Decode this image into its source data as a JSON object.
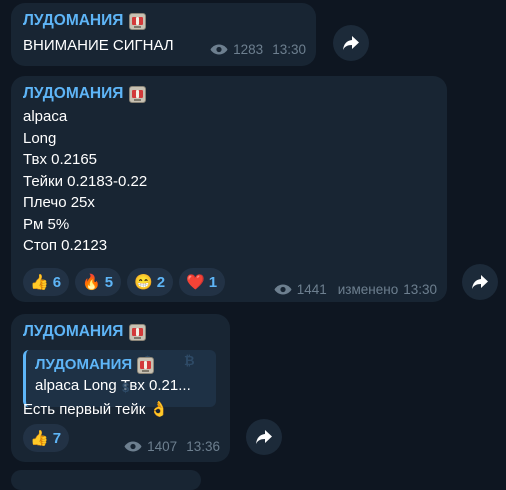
{
  "colors": {
    "background": "#0e1621",
    "bubble": "#182533",
    "accent": "#5eb5f7",
    "meta_text": "#6d7f8f"
  },
  "messages": [
    {
      "channel": "ЛУДОМАНИЯ",
      "channel_icon": "slot-machine-icon",
      "lines": [
        "ВНИМАНИЕ СИГНАЛ"
      ],
      "views": "1283",
      "time": "13:30"
    },
    {
      "channel": "ЛУДОМАНИЯ",
      "channel_icon": "slot-machine-icon",
      "lines": [
        "alpaca",
        "Long",
        "Твх 0.2165",
        "Тейки 0.2183-0.22",
        "Плечо 25х",
        "Рм 5%",
        "Стоп 0.2123"
      ],
      "reactions": [
        {
          "emoji": "👍",
          "count": "6"
        },
        {
          "emoji": "🔥",
          "count": "5"
        },
        {
          "emoji": "😁",
          "count": "2"
        },
        {
          "emoji": "❤️",
          "count": "1"
        }
      ],
      "views": "1441",
      "edited": "изменено",
      "time": "13:30"
    },
    {
      "channel": "ЛУДОМАНИЯ",
      "channel_icon": "slot-machine-icon",
      "reply": {
        "title": "ЛУДОМАНИЯ",
        "text": "alpaca Long Твх 0.21..."
      },
      "lines": [
        "Есть первый тейк 👌"
      ],
      "reactions": [
        {
          "emoji": "👍",
          "count": "7"
        }
      ],
      "views": "1407",
      "time": "13:36"
    }
  ]
}
